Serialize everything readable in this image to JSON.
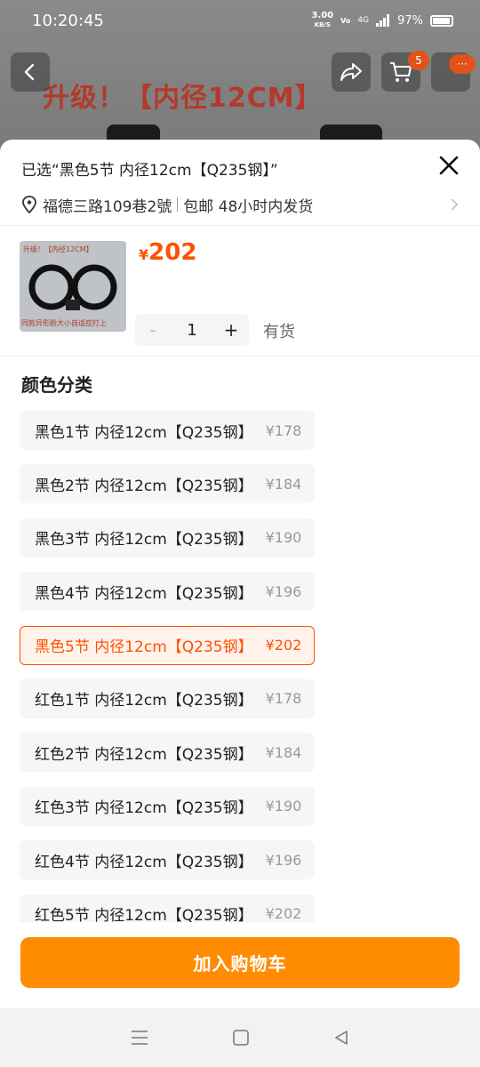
{
  "status": {
    "time": "10:20:45",
    "net_speed": "3.00",
    "net_unit": "KB/S",
    "volte": "Vo\nLTE",
    "signal": "4G",
    "battery": "97%"
  },
  "background": {
    "banner": "升级！【内径12CM】"
  },
  "header": {
    "cart_badge": "5",
    "more_badge": "···"
  },
  "sheet": {
    "selected_text": "已选“黑色5节 内径12cm【Q235钢】”",
    "address": "福德三路109巷2號",
    "shipping": "包邮 48小时内发货",
    "thumb_top": "升级！【内径12CM】",
    "thumb_bottom": "同款异形脸大小自适应打上",
    "price_symbol": "¥",
    "price": "202",
    "qty_minus": "-",
    "quantity": "1",
    "qty_plus": "+",
    "stock": "有货",
    "section_title": "颜色分类",
    "skus": [
      {
        "name": "黑色1节 内径12cm【Q235钢】",
        "price": "¥178"
      },
      {
        "name": "黑色2节 内径12cm【Q235钢】",
        "price": "¥184"
      },
      {
        "name": "黑色3节 内径12cm【Q235钢】",
        "price": "¥190"
      },
      {
        "name": "黑色4节 内径12cm【Q235钢】",
        "price": "¥196"
      },
      {
        "name": "黑色5节 内径12cm【Q235钢】",
        "price": "¥202"
      },
      {
        "name": "红色1节 内径12cm【Q235钢】",
        "price": "¥178"
      },
      {
        "name": "红色2节 内径12cm【Q235钢】",
        "price": "¥184"
      },
      {
        "name": "红色3节 内径12cm【Q235钢】",
        "price": "¥190"
      },
      {
        "name": "红色4节 内径12cm【Q235钢】",
        "price": "¥196"
      },
      {
        "name": "红色5节 内径12cm【Q235钢】",
        "price": "¥202"
      }
    ],
    "add_to_cart": "加入购物车"
  },
  "colors": {
    "accent": "#ff5000",
    "cart_button": "#ff8c00"
  },
  "icons": [
    "back-arrow-icon",
    "share-icon",
    "cart-icon",
    "more-icon",
    "close-icon",
    "location-pin-icon",
    "chevron-right-icon",
    "menu-icon",
    "home-icon",
    "back-triangle-icon"
  ]
}
